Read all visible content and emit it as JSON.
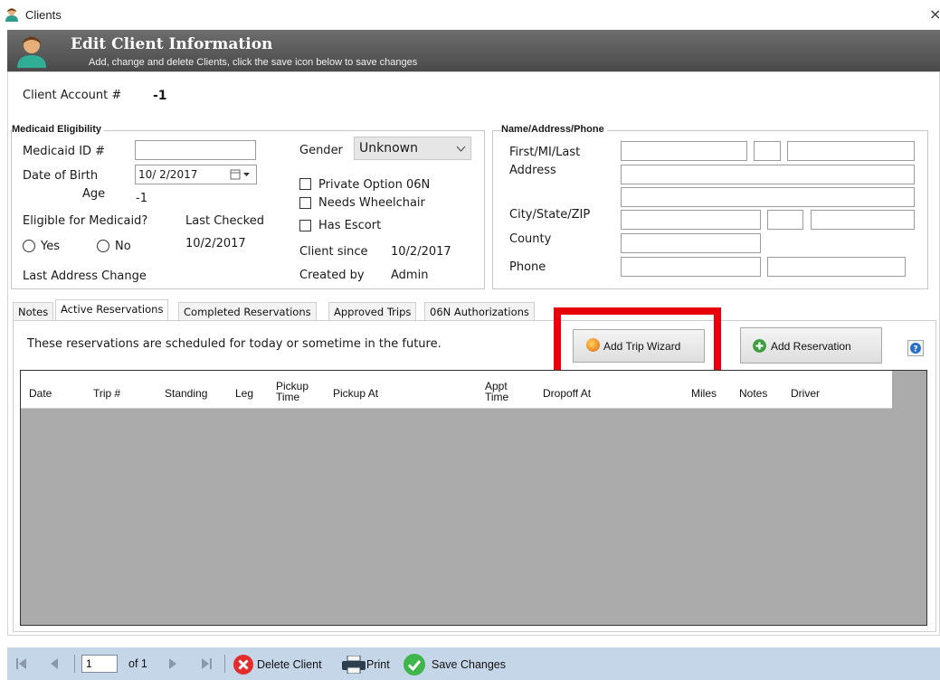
{
  "window": {
    "title": "Clients",
    "close_glyph": "×"
  },
  "header": {
    "title": "Edit Client Information",
    "subtitle": "Add, change and delete Clients, click the save icon below to save changes",
    "icon": "person-icon"
  },
  "account": {
    "label": "Client Account #",
    "value": "-1"
  },
  "medicaid": {
    "group_title": "Medicaid Eligibility",
    "id_label": "Medicaid ID #",
    "id_value": "",
    "dob_label": "Date of Birth",
    "dob_value": "10/ 2/2017",
    "age_label": "Age",
    "age_value": "-1",
    "eligible_label": "Eligible for Medicaid?",
    "yes_label": "Yes",
    "no_label": "No",
    "last_checked_label": "Last Checked",
    "last_checked_value": "10/2/2017",
    "last_address_label": "Last Address Change",
    "gender_label": "Gender",
    "gender_value": "Unknown",
    "private_option_label": "Private Option 06N",
    "wheelchair_label": "Needs Wheelchair",
    "escort_label": "Has Escort",
    "client_since_label": "Client since",
    "client_since_value": "10/2/2017",
    "created_by_label": "Created by",
    "created_by_value": "Admin"
  },
  "address": {
    "group_title": "Name/Address/Phone",
    "name_label": "First/MI/Last",
    "address_label": "Address",
    "city_label": "City/State/ZIP",
    "county_label": "County",
    "phone_label": "Phone"
  },
  "tabs": [
    {
      "label": "Notes",
      "active": false
    },
    {
      "label": "Active Reservations",
      "active": true
    },
    {
      "label": "Completed Reservations",
      "active": false
    },
    {
      "label": "Approved Trips",
      "active": false
    },
    {
      "label": "06N Authorizations",
      "active": false
    }
  ],
  "reservations": {
    "description": "These reservations are scheduled for today or sometime in the future.",
    "wizard_button": "Add Trip Wizard",
    "add_button": "Add Reservation",
    "help_icon": "help-icon",
    "columns": [
      "Date",
      "Trip #",
      "Standing",
      "Leg",
      "Pickup\nTime",
      "Pickup At",
      "Appt\nTime",
      "Dropoff At",
      "Miles",
      "Notes",
      "Driver"
    ],
    "rows": []
  },
  "highlight_color": "#e8000b",
  "navigator": {
    "page_value": "1",
    "of_label": "of 1",
    "delete_label": "Delete Client",
    "print_label": "Print",
    "save_label": "Save Changes"
  }
}
